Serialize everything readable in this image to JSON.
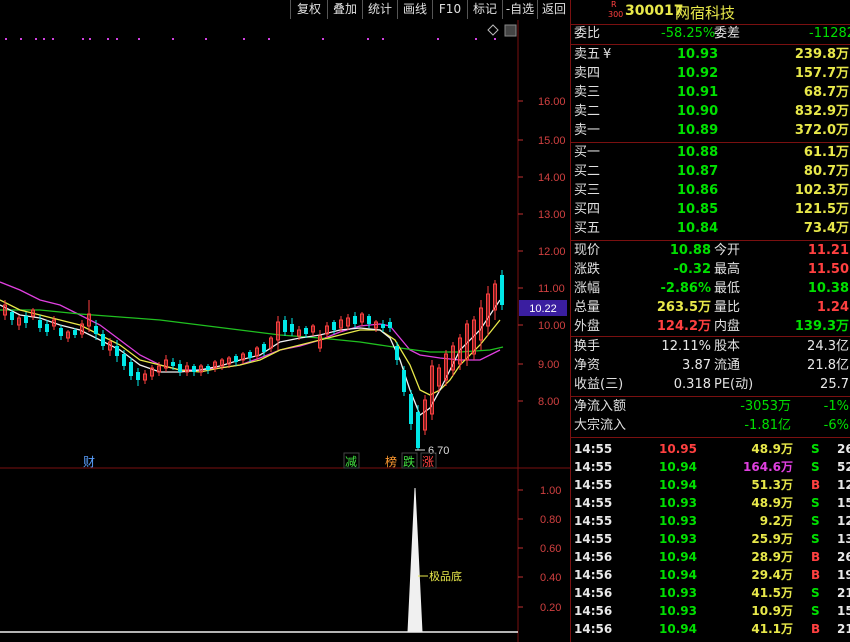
{
  "toolbar": {
    "buttons": [
      "复权",
      "叠加",
      "统计",
      "画线",
      "F10",
      "标记",
      "-自选",
      "返回"
    ]
  },
  "stock": {
    "badge_top": "R",
    "badge_bottom": "300",
    "code": "300017",
    "name": "网宿科技"
  },
  "price_axis": {
    "ticks": [
      "16.00",
      "15.00",
      "14.00",
      "13.00",
      "12.00",
      "11.00",
      "10.00",
      "9.00",
      "8.00"
    ],
    "current_price_label": "10.22"
  },
  "annotations": {
    "low_label": "6.70",
    "events": [
      "财",
      "减",
      "榜",
      "跌",
      "涨"
    ],
    "indicator_label": "极品底"
  },
  "indicator_axis": {
    "ticks": [
      "1.00",
      "0.80",
      "0.60",
      "0.40",
      "0.20"
    ]
  },
  "quote": {
    "weibi_label": "委比",
    "weibi_value": "-58.25%",
    "weicha_label": "委差",
    "weicha_value": "-11282",
    "sell": [
      {
        "label": "卖五",
        "mark": "¥",
        "price": "10.93",
        "vol": "239.8万"
      },
      {
        "label": "卖四",
        "mark": "",
        "price": "10.92",
        "vol": "157.7万"
      },
      {
        "label": "卖三",
        "mark": "",
        "price": "10.91",
        "vol": "68.7万"
      },
      {
        "label": "卖二",
        "mark": "",
        "price": "10.90",
        "vol": "832.9万"
      },
      {
        "label": "卖一",
        "mark": "",
        "price": "10.89",
        "vol": "372.0万"
      }
    ],
    "buy": [
      {
        "label": "买一",
        "price": "10.88",
        "vol": "61.1万"
      },
      {
        "label": "买二",
        "price": "10.87",
        "vol": "80.7万"
      },
      {
        "label": "买三",
        "price": "10.86",
        "vol": "102.3万"
      },
      {
        "label": "买四",
        "price": "10.85",
        "vol": "121.5万"
      },
      {
        "label": "买五",
        "price": "10.84",
        "vol": "73.4万"
      }
    ],
    "stats": [
      {
        "l1": "现价",
        "v1": "10.88",
        "c1": "dn",
        "l2": "今开",
        "v2": "11.21",
        "c2": "up"
      },
      {
        "l1": "涨跌",
        "v1": "-0.32",
        "c1": "dn",
        "l2": "最高",
        "v2": "11.50",
        "c2": "up"
      },
      {
        "l1": "涨幅",
        "v1": "-2.86%",
        "c1": "dn",
        "l2": "最低",
        "v2": "10.38",
        "c2": "dn"
      },
      {
        "l1": "总量",
        "v1": "263.5万",
        "c1": "yl",
        "l2": "量比",
        "v2": "1.24",
        "c2": "up"
      },
      {
        "l1": "外盘",
        "v1": "124.2万",
        "c1": "up",
        "l2": "内盘",
        "v2": "139.3万",
        "c2": "dn"
      }
    ],
    "stats2": [
      {
        "l1": "换手",
        "v1": "12.11%",
        "l2": "股本",
        "v2": "24.3亿"
      },
      {
        "l1": "净资",
        "v1": "3.87",
        "l2": "流通",
        "v2": "21.8亿"
      },
      {
        "l1": "收益(三)",
        "v1": "0.318",
        "l2": "PE(动)",
        "v2": "25.7"
      }
    ],
    "flows": [
      {
        "label": "净流入额",
        "value": "-3053万",
        "pct": "-1%"
      },
      {
        "label": "大宗流入",
        "value": "-1.81亿",
        "pct": "-6%"
      }
    ]
  },
  "trades": [
    {
      "time": "14:55",
      "price": "10.95",
      "vol": "48.9万",
      "side": "S",
      "n": "26",
      "pc": "up",
      "vc": "yl"
    },
    {
      "time": "14:55",
      "price": "10.94",
      "vol": "164.6万",
      "side": "S",
      "n": "52",
      "pc": "dn",
      "vc": "pk"
    },
    {
      "time": "14:55",
      "price": "10.94",
      "vol": "51.3万",
      "side": "B",
      "n": "12",
      "pc": "dn",
      "vc": "yl"
    },
    {
      "time": "14:55",
      "price": "10.93",
      "vol": "48.9万",
      "side": "S",
      "n": "15",
      "pc": "dn",
      "vc": "yl"
    },
    {
      "time": "14:55",
      "price": "10.93",
      "vol": "9.2万",
      "side": "S",
      "n": "12",
      "pc": "dn",
      "vc": "yl"
    },
    {
      "time": "14:55",
      "price": "10.93",
      "vol": "25.9万",
      "side": "S",
      "n": "13",
      "pc": "dn",
      "vc": "yl"
    },
    {
      "time": "14:56",
      "price": "10.94",
      "vol": "28.9万",
      "side": "B",
      "n": "26",
      "pc": "dn",
      "vc": "yl"
    },
    {
      "time": "14:56",
      "price": "10.94",
      "vol": "29.4万",
      "side": "B",
      "n": "19",
      "pc": "dn",
      "vc": "yl"
    },
    {
      "time": "14:56",
      "price": "10.93",
      "vol": "41.5万",
      "side": "S",
      "n": "21",
      "pc": "dn",
      "vc": "yl"
    },
    {
      "time": "14:56",
      "price": "10.93",
      "vol": "10.9万",
      "side": "S",
      "n": "15",
      "pc": "dn",
      "vc": "yl"
    },
    {
      "time": "14:56",
      "price": "10.94",
      "vol": "41.1万",
      "side": "B",
      "n": "21",
      "pc": "dn",
      "vc": "yl"
    }
  ],
  "colors": {
    "up": "#ff4040",
    "down": "#00e000",
    "yellow": "#e8e84a",
    "pink": "#e040e0",
    "cyan": "#00d8e8",
    "border": "#7a1010"
  }
}
